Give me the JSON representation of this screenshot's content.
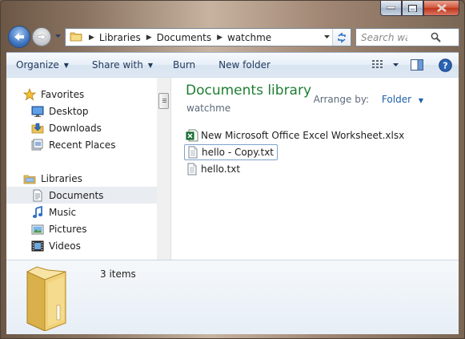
{
  "window": {
    "caption_buttons": [
      "minimize",
      "maximize",
      "close"
    ]
  },
  "navigation": {
    "breadcrumb": [
      "Libraries",
      "Documents",
      "watchme"
    ],
    "search_placeholder": "Search wat..."
  },
  "toolbar": {
    "organize": "Organize",
    "share_with": "Share with",
    "burn": "Burn",
    "new_folder": "New folder"
  },
  "sidebar": {
    "favorites": {
      "label": "Favorites",
      "items": [
        {
          "label": "Desktop",
          "icon": "desktop-icon"
        },
        {
          "label": "Downloads",
          "icon": "downloads-icon"
        },
        {
          "label": "Recent Places",
          "icon": "recent-places-icon"
        }
      ]
    },
    "libraries": {
      "label": "Libraries",
      "items": [
        {
          "label": "Documents",
          "icon": "documents-icon",
          "selected": true
        },
        {
          "label": "Music",
          "icon": "music-icon"
        },
        {
          "label": "Pictures",
          "icon": "pictures-icon"
        },
        {
          "label": "Videos",
          "icon": "videos-icon"
        }
      ]
    }
  },
  "library": {
    "title": "Documents library",
    "subtitle": "watchme",
    "arrange_label": "Arrange by:",
    "arrange_value": "Folder"
  },
  "files": [
    {
      "name": "New Microsoft Office Excel Worksheet.xlsx",
      "icon": "excel-file-icon"
    },
    {
      "name": "hello - Copy.txt",
      "icon": "text-file-icon",
      "focused": true
    },
    {
      "name": "hello.txt",
      "icon": "text-file-icon"
    }
  ],
  "details": {
    "item_count": "3 items"
  },
  "colors": {
    "library_title": "#1e7e32",
    "toolbar_text": "#1e395b",
    "link_blue": "#1e5fa8",
    "selection": "#e9edf2"
  }
}
